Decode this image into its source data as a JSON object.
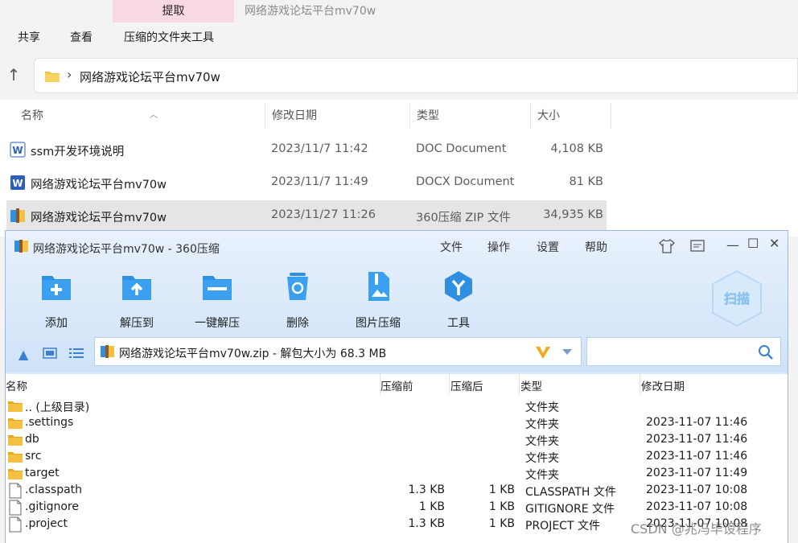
{
  "ribbon": {
    "context_tab": "提取",
    "window_title": "网络游戏论坛平台mv70w",
    "menu": [
      "共享",
      "查看",
      "压缩的文件夹工具"
    ]
  },
  "address": {
    "path": "网络游戏论坛平台mv70w"
  },
  "columns": {
    "name": "名称",
    "modified": "修改日期",
    "type": "类型",
    "size": "大小"
  },
  "files": [
    {
      "name": "ssm开发环境说明",
      "modified": "2023/11/7 11:42",
      "type": "DOC Document",
      "size": "4,108 KB",
      "icon": "word-doc-icon"
    },
    {
      "name": "网络游戏论坛平台mv70w",
      "modified": "2023/11/7 11:49",
      "type": "DOCX Document",
      "size": "81 KB",
      "icon": "word-docx-icon"
    },
    {
      "name": "网络游戏论坛平台mv70w",
      "modified": "2023/11/27 11:26",
      "type": "360压缩 ZIP 文件",
      "size": "34,935 KB",
      "icon": "zip-archive-icon"
    }
  ],
  "zip": {
    "title": "网络游戏论坛平台mv70w - 360压缩",
    "menu": [
      "文件",
      "操作",
      "设置",
      "帮助"
    ],
    "tools": [
      {
        "label": "添加",
        "icon": "add-icon"
      },
      {
        "label": "解压到",
        "icon": "extract-to-icon"
      },
      {
        "label": "一键解压",
        "icon": "one-click-extract-icon"
      },
      {
        "label": "删除",
        "icon": "delete-icon"
      },
      {
        "label": "图片压缩",
        "icon": "image-compress-icon"
      },
      {
        "label": "工具",
        "icon": "tools-icon"
      }
    ],
    "scan_label": "扫描",
    "path": "网络游戏论坛平台mv70w.zip - 解包大小为 68.3 MB",
    "headers": {
      "name": "名称",
      "before": "压缩前",
      "after": "压缩后",
      "type": "类型",
      "modified": "修改日期"
    },
    "rows": [
      {
        "name": ".. (上级目录)",
        "before": "",
        "after": "",
        "type": "文件夹",
        "modified": "",
        "icon": "folder-icon"
      },
      {
        "name": ".settings",
        "before": "",
        "after": "",
        "type": "文件夹",
        "modified": "2023-11-07 11:46",
        "icon": "folder-icon"
      },
      {
        "name": "db",
        "before": "",
        "after": "",
        "type": "文件夹",
        "modified": "2023-11-07 11:46",
        "icon": "folder-icon"
      },
      {
        "name": "src",
        "before": "",
        "after": "",
        "type": "文件夹",
        "modified": "2023-11-07 11:46",
        "icon": "folder-icon"
      },
      {
        "name": "target",
        "before": "",
        "after": "",
        "type": "文件夹",
        "modified": "2023-11-07 11:49",
        "icon": "folder-icon"
      },
      {
        "name": ".classpath",
        "before": "1.3 KB",
        "after": "1 KB",
        "type": "CLASSPATH 文件",
        "modified": "2023-11-07 10:08",
        "icon": "file-icon"
      },
      {
        "name": ".gitignore",
        "before": "1 KB",
        "after": "1 KB",
        "type": "GITIGNORE 文件",
        "modified": "2023-11-07 10:08",
        "icon": "file-icon"
      },
      {
        "name": ".project",
        "before": "1.3 KB",
        "after": "1 KB",
        "type": "PROJECT 文件",
        "modified": "2023-11-07 10:08",
        "icon": "file-icon"
      }
    ]
  },
  "watermark": "CSDN @兆冯毕设程序",
  "colors": {
    "accent_tab": "#f9d8e6",
    "zip_blue": "#2f8fe0",
    "folder": "#f4c042"
  }
}
